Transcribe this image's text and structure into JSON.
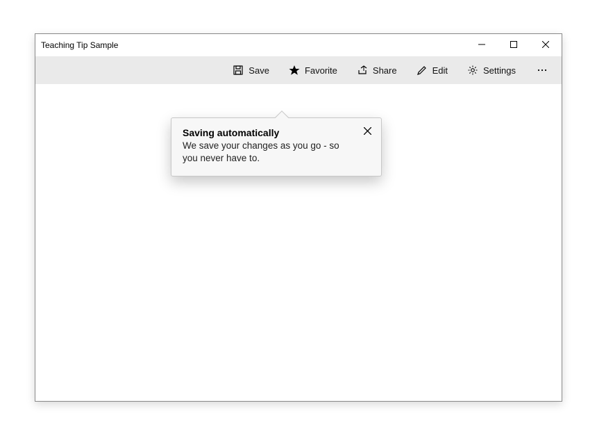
{
  "window": {
    "title": "Teaching Tip Sample"
  },
  "commandbar": {
    "save_label": "Save",
    "favorite_label": "Favorite",
    "share_label": "Share",
    "edit_label": "Edit",
    "settings_label": "Settings"
  },
  "tip": {
    "title": "Saving automatically",
    "body": "We save your changes as you go - so you never have to."
  }
}
